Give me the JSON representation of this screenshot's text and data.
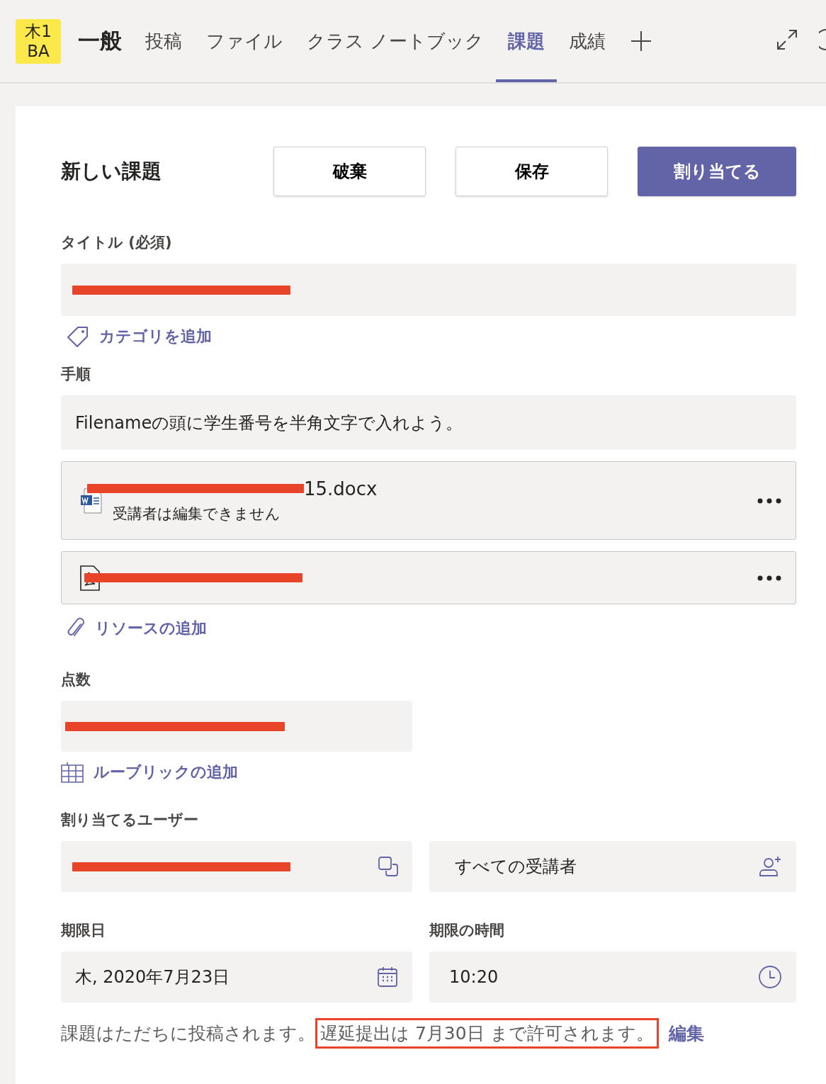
{
  "header": {
    "team_badge": [
      "木1",
      "BA"
    ],
    "channel": "一般",
    "tabs": [
      {
        "label": "投稿",
        "selected": false
      },
      {
        "label": "ファイル",
        "selected": false
      },
      {
        "label": "クラス ノートブック",
        "selected": false
      },
      {
        "label": "課題",
        "selected": true
      },
      {
        "label": "成績",
        "selected": false
      }
    ]
  },
  "form": {
    "heading": "新しい課題",
    "buttons": [
      {
        "label": "破棄",
        "kind": "secondary"
      },
      {
        "label": "保存",
        "kind": "secondary"
      },
      {
        "label": "割り当てる",
        "kind": "primary"
      }
    ],
    "title_label": "タイトル (必須)",
    "title_field": {
      "redacted": true
    },
    "category_link": "カテゴリを追加",
    "instructions_label": "手順",
    "instructions": "Filenameの頭に学生番号を半角文字で入れよう。",
    "attachments": [
      {
        "kind": "word",
        "redacted": true,
        "name": "15.docx",
        "note": "受講者は編集できません"
      },
      {
        "kind": "pdf",
        "redacted": true
      }
    ],
    "resource_link": "リソースの追加",
    "points_label": "点数",
    "points_field": {
      "redacted": true
    },
    "rubric_link": "ルーブリックの追加",
    "assign_label": "割り当てるユーザー",
    "class_field": {
      "redacted": true
    },
    "students_field": {
      "value": "すべての受講者"
    },
    "due_date_label": "期限日",
    "due_date": "木, 2020年7月23日",
    "due_time_label": "期限の時間",
    "due_time": "10:20",
    "posting_note": "課題はただちに投稿されます。",
    "late_notice": {
      "text": "遅延提出は 7月30日 まで許可されます。",
      "highlighted": true
    },
    "edit_link": "編集"
  }
}
